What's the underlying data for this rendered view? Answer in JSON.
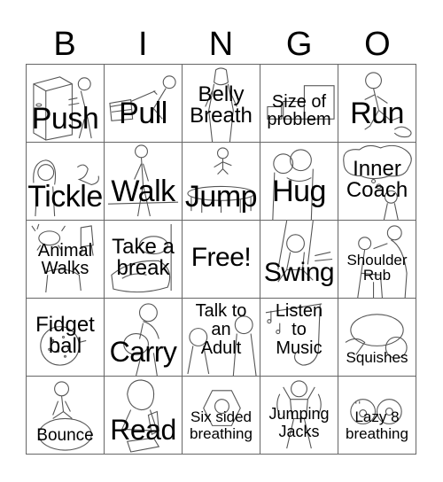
{
  "header": {
    "letters": [
      "B",
      "I",
      "N",
      "G",
      "O"
    ]
  },
  "cells": [
    {
      "label": "Push",
      "icon": "boy-pushing-box-icon"
    },
    {
      "label": "Pull",
      "icon": "boy-pulling-cart-icon"
    },
    {
      "label": "Belly\nBreath",
      "icon": "person-breathing-icon"
    },
    {
      "label": "Size of\nproblem",
      "icon": "stepped-boxes-icon"
    },
    {
      "label": "Run",
      "icon": "boy-running-icon"
    },
    {
      "label": "Tickle",
      "icon": "girl-tickling-feet-icon"
    },
    {
      "label": "Walk",
      "icon": "man-walking-icon"
    },
    {
      "label": "Jump",
      "icon": "child-trampoline-icon"
    },
    {
      "label": "Hug",
      "icon": "two-people-hugging-icon"
    },
    {
      "label": "Inner\nCoach",
      "icon": "girl-thought-bubble-icon"
    },
    {
      "label": "Animal\nWalks",
      "icon": "crab-and-dog-icon"
    },
    {
      "label": "Take a\nbreak",
      "icon": "person-resting-icon"
    },
    {
      "label": "Free!",
      "icon": ""
    },
    {
      "label": "Swing",
      "icon": "girl-on-swing-icon"
    },
    {
      "label": "Shoulder\nRub",
      "icon": "shoulder-massage-icon"
    },
    {
      "label": "Fidget\nball",
      "icon": "spiky-ball-icon"
    },
    {
      "label": "Carry",
      "icon": "boy-carrying-ball-icon"
    },
    {
      "label": "Talk to\nan\nAdult",
      "icon": "child-and-adult-icon"
    },
    {
      "label": "Listen\nto\nMusic",
      "icon": "saxophone-music-notes-icon"
    },
    {
      "label": "Squishes",
      "icon": "girl-under-pillow-icon"
    },
    {
      "label": "Bounce",
      "icon": "boy-on-ball-icon"
    },
    {
      "label": "Read",
      "icon": "woman-reading-icon"
    },
    {
      "label": "Six sided\nbreathing",
      "icon": "hexagon-face-icon"
    },
    {
      "label": "Jumping\nJacks",
      "icon": "boy-jumping-jacks-icon"
    },
    {
      "label": "Lazy 8\nbreathing",
      "icon": "figure-eight-icon"
    }
  ]
}
